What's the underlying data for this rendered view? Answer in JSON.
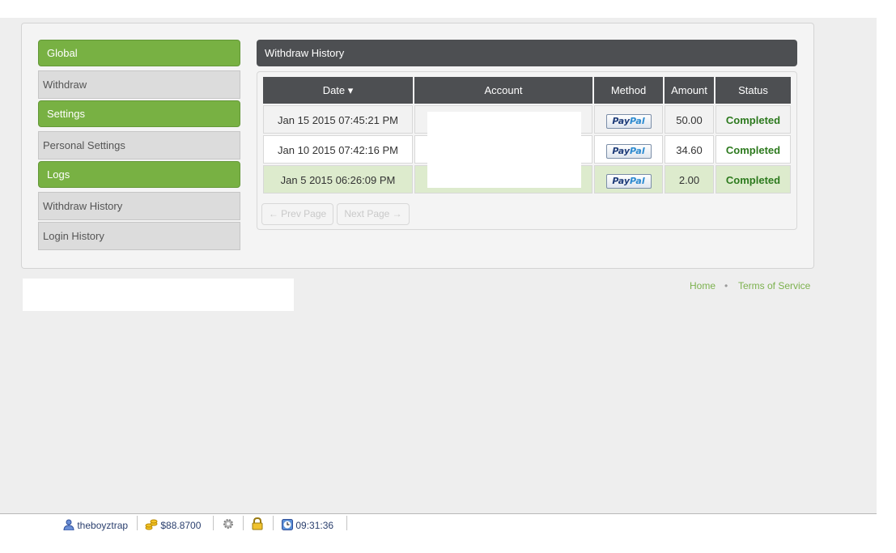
{
  "sidebar": {
    "global_heading": "Global",
    "withdraw": "Withdraw",
    "settings_heading": "Settings",
    "personal_settings": "Personal Settings",
    "logs_heading": "Logs",
    "withdraw_history": "Withdraw History",
    "login_history": "Login History"
  },
  "panel": {
    "title": "Withdraw History"
  },
  "table": {
    "columns": {
      "date": "Date ▾",
      "account": "Account",
      "method": "Method",
      "amount": "Amount",
      "status": "Status"
    },
    "rows": [
      {
        "date": "Jan 15 2015 07:45:21 PM",
        "method": "PayPal",
        "amount": "50.00",
        "status": "Completed"
      },
      {
        "date": "Jan 10 2015 07:42:16 PM",
        "method": "PayPal",
        "amount": "34.60",
        "status": "Completed"
      },
      {
        "date": "Jan 5 2015 06:26:09 PM",
        "method": "PayPal",
        "amount": "2.00",
        "status": "Completed"
      }
    ]
  },
  "pager": {
    "prev": "← Prev Page",
    "next": "Next Page →"
  },
  "footer": {
    "home": "Home",
    "terms": "Terms of Service"
  },
  "taskbar": {
    "username": "theboyztrap",
    "balance": "$88.8700",
    "clock": "09:31:36"
  },
  "colors": {
    "accent_green": "#78b143",
    "header_dark": "#4d4f52",
    "status_green": "#2d7a1e",
    "link_green": "#7cb14e"
  }
}
